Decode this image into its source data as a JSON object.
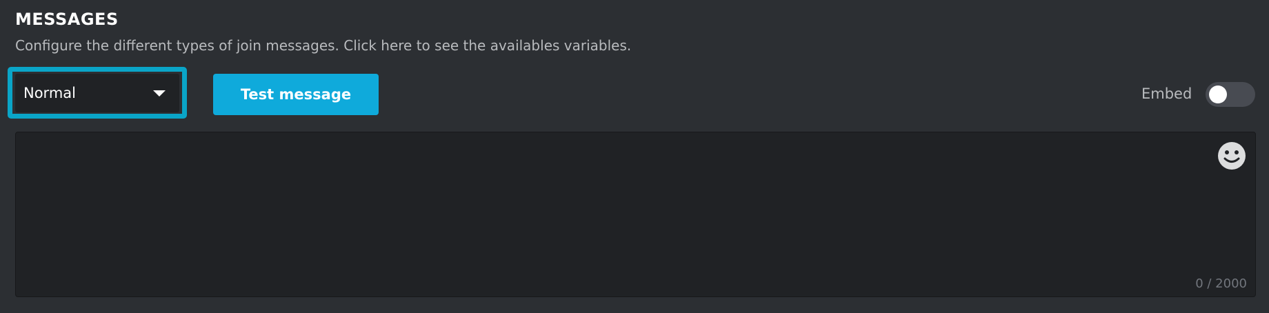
{
  "header": {
    "title": "MESSAGES",
    "subtitle_prefix": "Configure the different types of join messages. ",
    "subtitle_link": "Click here",
    "subtitle_suffix": " to see the availables variables."
  },
  "controls": {
    "message_type": {
      "selected": "Normal"
    },
    "test_button_label": "Test message",
    "embed_label": "Embed",
    "embed_enabled": false
  },
  "editor": {
    "value": "",
    "emoji_icon": "smiley-face-icon",
    "counter": "0 / 2000"
  },
  "colors": {
    "background": "#2c2f33",
    "input_background": "#202225",
    "accent": "#0faadb",
    "highlight": "#0aa5c8"
  }
}
